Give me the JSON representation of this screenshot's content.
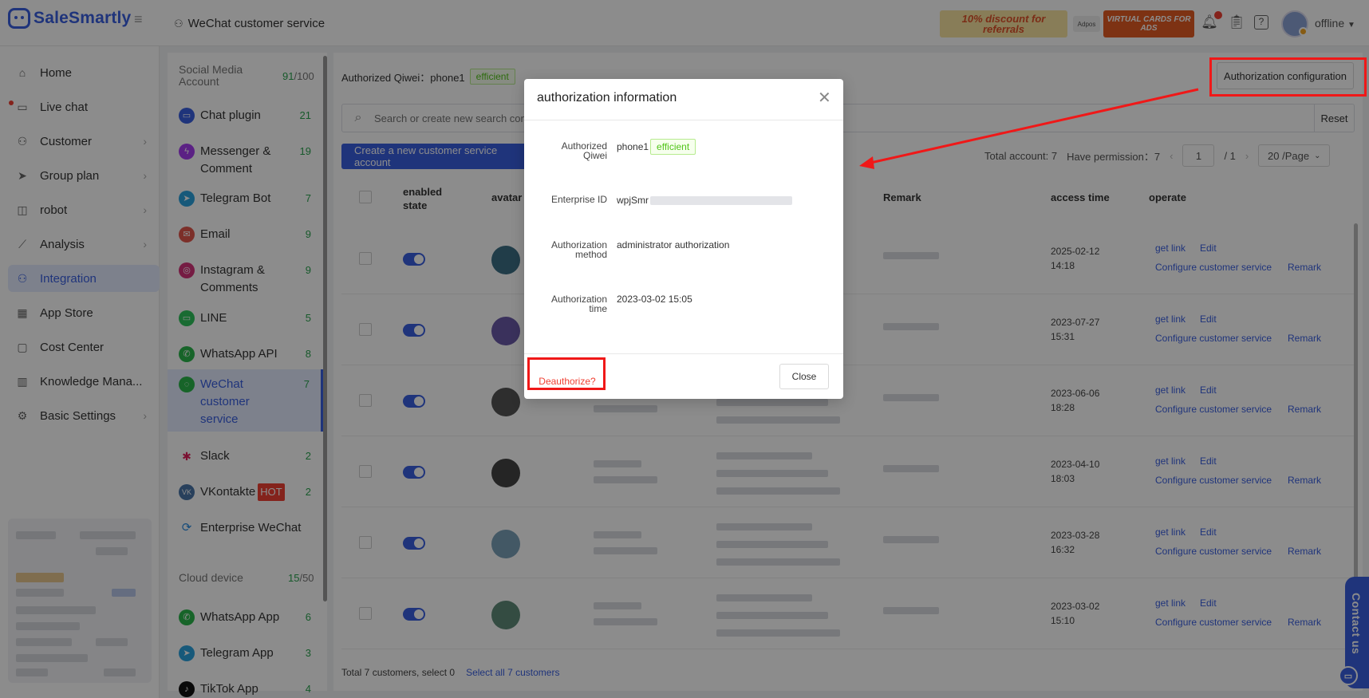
{
  "app": {
    "brand": "SaleSmartly",
    "breadcrumb": "WeChat customer service"
  },
  "topbar": {
    "promo_referral": "10% discount for referrals",
    "promo_small": "Adpos",
    "promo_cards": "VIRTUAL CARDS FOR ADS",
    "user_status": "offline",
    "icons": [
      "bell-icon",
      "clipboard-icon",
      "help-icon",
      "avatar"
    ]
  },
  "sidebar": {
    "items": [
      {
        "label": "Home",
        "icon": "home-icon"
      },
      {
        "label": "Live chat",
        "icon": "chat-icon"
      },
      {
        "label": "Customer",
        "icon": "users-icon"
      },
      {
        "label": "Group plan",
        "icon": "send-icon"
      },
      {
        "label": "robot",
        "icon": "robot-icon"
      },
      {
        "label": "Analysis",
        "icon": "chart-icon"
      },
      {
        "label": "Integration",
        "icon": "integration-icon"
      },
      {
        "label": "App Store",
        "icon": "apps-icon"
      },
      {
        "label": "Cost Center",
        "icon": "wallet-icon"
      },
      {
        "label": "Knowledge Mana...",
        "icon": "book-icon"
      },
      {
        "label": "Basic Settings",
        "icon": "gear-icon"
      }
    ]
  },
  "channels": {
    "social_title": "Social Media Account",
    "social_used": "91",
    "social_total": "/100",
    "items": [
      {
        "label": "Chat plugin",
        "count": "21"
      },
      {
        "label": "Messenger & Comment",
        "count": "19"
      },
      {
        "label": "Telegram Bot",
        "count": "7"
      },
      {
        "label": "Email",
        "count": "9"
      },
      {
        "label": "Instagram & Comments",
        "count": "9"
      },
      {
        "label": "LINE",
        "count": "5"
      },
      {
        "label": "WhatsApp API",
        "count": "8"
      },
      {
        "label": "WeChat customer service",
        "count": "7"
      },
      {
        "label": "Slack",
        "count": "2"
      },
      {
        "label": "VKontakte",
        "badge": "HOT",
        "count": "2"
      },
      {
        "label": "Enterprise WeChat",
        "count": ""
      }
    ],
    "cloud_title": "Cloud device",
    "cloud_used": "15",
    "cloud_total": "/50",
    "cloud_items": [
      {
        "label": "WhatsApp App",
        "count": "6"
      },
      {
        "label": "Telegram App",
        "count": "3"
      },
      {
        "label": "TikTok App",
        "count": "4"
      }
    ]
  },
  "main": {
    "auth_label": "Authorized Qiwei：",
    "auth_name": "phone1",
    "auth_status": "efficient",
    "auth_config_button": "Authorization configuration",
    "search_placeholder": "Search or create new search cond",
    "reset_button": "Reset",
    "create_button": "Create a new customer service account",
    "pager": {
      "total": "Total account: 7",
      "permission": "Have permission：7",
      "page": "1",
      "pages": "/ 1",
      "per_page": "20 /Page"
    },
    "columns": {
      "state": "enabled state",
      "avatar": "avatar",
      "remark": "Remark",
      "access_time": "access time",
      "operate": "operate"
    },
    "rows": [
      {
        "date": "2025-02-12",
        "time": "14:18"
      },
      {
        "date": "2023-07-27",
        "time": "15:31"
      },
      {
        "date": "2023-06-06",
        "time": "18:28"
      },
      {
        "date": "2023-04-10",
        "time": "18:03"
      },
      {
        "date": "2023-03-28",
        "time": "16:32"
      },
      {
        "date": "2023-03-02",
        "time": "15:10"
      }
    ],
    "row_actions": {
      "get_link": "get link",
      "edit": "Edit",
      "configure": "Configure customer service",
      "remark": "Remark"
    },
    "footer_total": "Total 7 customers, select 0",
    "footer_select_all": "Select all 7 customers"
  },
  "modal": {
    "title": "authorization information",
    "fields": {
      "qiwei_label": "Authorized Qiwei",
      "qiwei_value": "phone1",
      "qiwei_status": "efficient",
      "enterprise_label": "Enterprise ID",
      "enterprise_value": "wpjSmr",
      "method_label": "Authorization method",
      "method_value": "administrator authorization",
      "time_label": "Authorization time",
      "time_value": "2023-03-02 15:05"
    },
    "deauthorize": "Deauthorize?",
    "close": "Close"
  },
  "contact_us": "Contact us",
  "colors": {
    "accent": "#3a5fe0",
    "success": "#52c41a",
    "danger": "#f04134",
    "annotation": "#f01818"
  }
}
